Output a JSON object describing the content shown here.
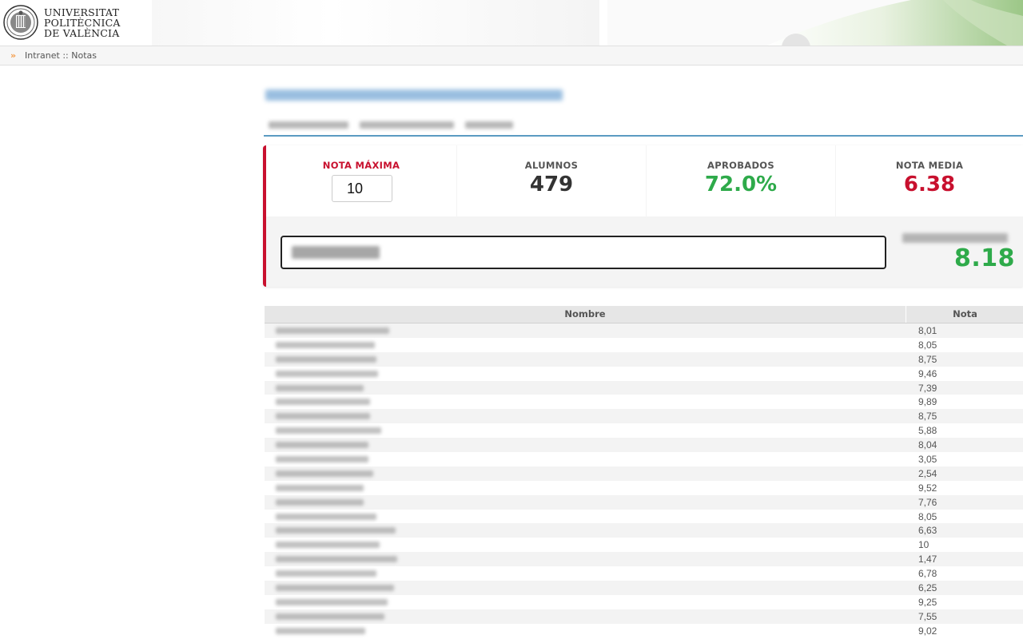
{
  "header": {
    "logo_lines": [
      "UNIVERSITAT",
      "POLITÈCNICA",
      "DE VALÈNCIA"
    ]
  },
  "breadcrumb": {
    "arrow": "»",
    "text": "Intranet :: Notas"
  },
  "stats": {
    "max_label": "NOTA MÁXIMA",
    "max_value": "10",
    "students_label": "ALUMNOS",
    "students_value": "479",
    "passed_label": "APROBADOS",
    "passed_value": "72.0%",
    "average_label": "NOTA MEDIA",
    "average_value": "6.38",
    "colors": {
      "accent": "#c8102e",
      "green": "#2eaa4a",
      "dark": "#333333"
    }
  },
  "selected_student": {
    "grade": "8.18"
  },
  "table": {
    "headers": {
      "name": "Nombre",
      "grade": "Nota"
    },
    "rows": [
      {
        "grade": "8,01"
      },
      {
        "grade": "8,05"
      },
      {
        "grade": "8,75"
      },
      {
        "grade": "9,46"
      },
      {
        "grade": "7,39"
      },
      {
        "grade": "9,89"
      },
      {
        "grade": "8,75"
      },
      {
        "grade": "5,88"
      },
      {
        "grade": "8,04"
      },
      {
        "grade": "3,05"
      },
      {
        "grade": "2,54"
      },
      {
        "grade": "9,52"
      },
      {
        "grade": "7,76"
      },
      {
        "grade": "8,05"
      },
      {
        "grade": "6,63"
      },
      {
        "grade": "10"
      },
      {
        "grade": "1,47"
      },
      {
        "grade": "6,78"
      },
      {
        "grade": "6,25"
      },
      {
        "grade": "9,25"
      },
      {
        "grade": "7,55"
      },
      {
        "grade": "9,02"
      }
    ]
  }
}
